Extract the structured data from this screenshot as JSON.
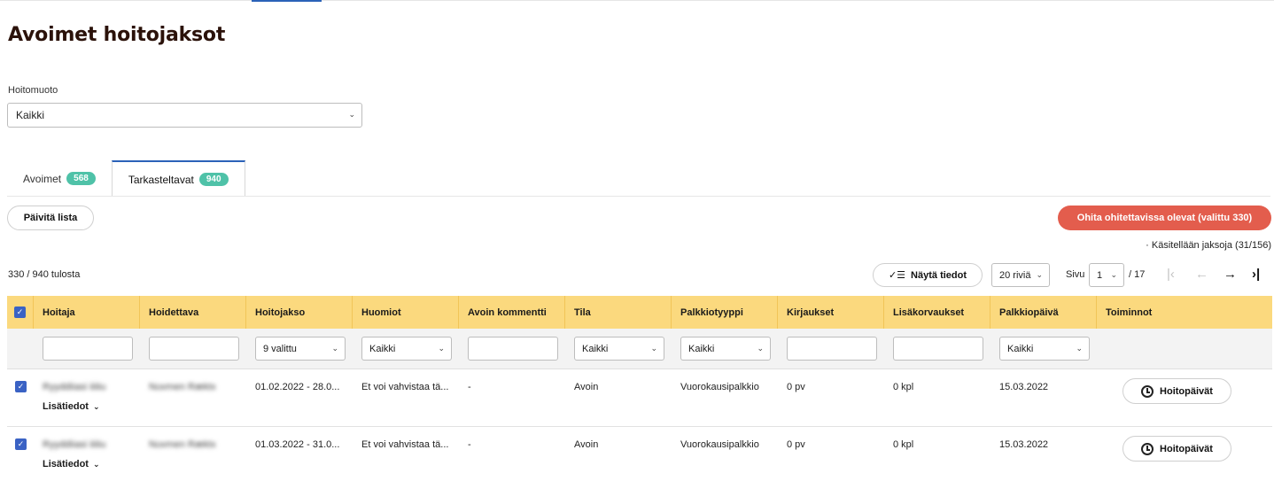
{
  "page": {
    "title": "Avoimet hoitojaksot"
  },
  "filter": {
    "label": "Hoitomuoto",
    "value": "Kaikki"
  },
  "tabs": [
    {
      "label": "Avoimet",
      "count": "568",
      "active": false
    },
    {
      "label": "Tarkasteltavat",
      "count": "940",
      "active": true
    }
  ],
  "actions": {
    "refresh": "Päivitä lista",
    "skip": "Ohita ohitettavissa olevat (valittu 330)",
    "progress": "· Käsitellään jaksoja (31/156)"
  },
  "toolbar": {
    "count": "330 / 940 tulosta",
    "show_details": "Näytä tiedot",
    "rows_per_page": "20 riviä",
    "page_label": "Sivu",
    "page_value": "1",
    "page_total": "/ 17",
    "first_icon": "first-page-icon",
    "prev_icon": "previous-page-icon",
    "next_icon": "next-page-icon",
    "last_icon": "last-page-icon"
  },
  "table": {
    "columns": [
      "Hoitaja",
      "Hoidettava",
      "Hoitojakso",
      "Huomiot",
      "Avoin kommentti",
      "Tila",
      "Palkkiotyyppi",
      "Kirjaukset",
      "Lisäkorvaukset",
      "Palkkiopäivä",
      "Toiminnot"
    ],
    "filters": {
      "hoitojakso": "9 valittu",
      "huomiot": "Kaikki",
      "tila": "Kaikki",
      "palkkiotyyppi": "Kaikki",
      "palkkiopaiva": "Kaikki"
    },
    "rows": [
      {
        "hoitaja": "Ryyddiiasi iiiiiu",
        "hoidettava": "Nuvmen Ræktx",
        "hoitojakso": "01.02.2022 - 28.0...",
        "huomiot": "Et voi vahvistaa tä...",
        "kommentti": "-",
        "tila": "Avoin",
        "palkkiotyyppi": "Vuorokausipalkkio",
        "kirjaukset": "0 pv",
        "lisakorvaukset": "0 kpl",
        "palkkiopaiva": "15.03.2022",
        "action": "Hoitopäivät",
        "more": "Lisätiedot"
      },
      {
        "hoitaja": "Ryyddiiasi iiiiiu",
        "hoidettava": "Nuvmen Ræktx",
        "hoitojakso": "01.03.2022 - 31.0...",
        "huomiot": "Et voi vahvistaa tä...",
        "kommentti": "-",
        "tila": "Avoin",
        "palkkiotyyppi": "Vuorokausipalkkio",
        "kirjaukset": "0 pv",
        "lisakorvaukset": "0 kpl",
        "palkkiopaiva": "15.03.2022",
        "action": "Hoitopäivät",
        "more": "Lisätiedot"
      }
    ]
  },
  "colors": {
    "accent": "#2b62b8",
    "header": "#fbd97e",
    "danger": "#e35d4d",
    "badge": "#4fc2a8"
  }
}
